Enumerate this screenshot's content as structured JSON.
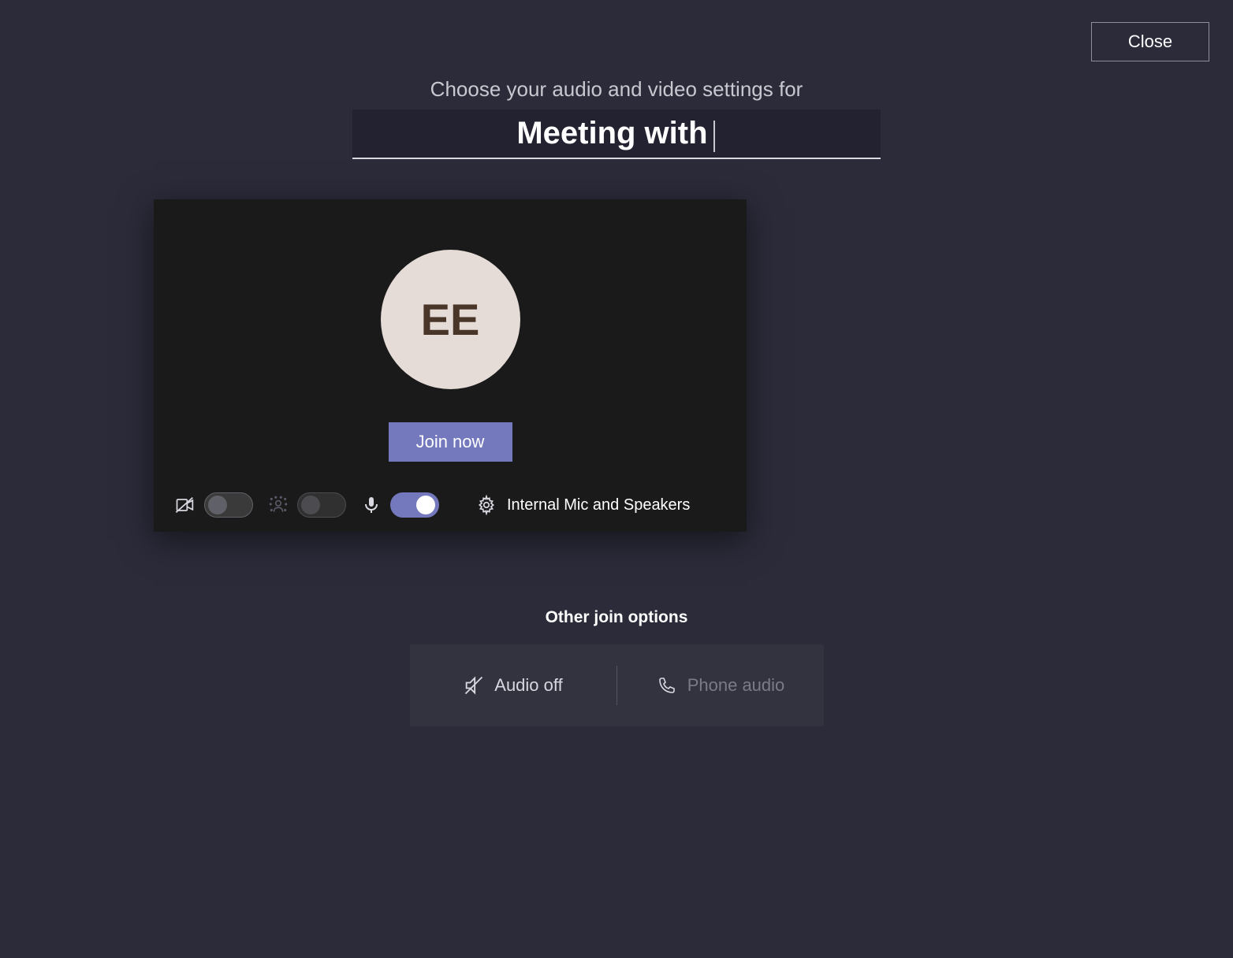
{
  "close_label": "Close",
  "subtitle": "Choose your audio and video settings for",
  "meeting_title": "Meeting with ",
  "avatar_initials": "EE",
  "join_label": "Join now",
  "device_label": "Internal Mic and Speakers",
  "toggles": {
    "camera": false,
    "blur": false,
    "mic": true
  },
  "other_options": {
    "title": "Other join options",
    "audio_off": "Audio off",
    "phone_audio": "Phone audio"
  }
}
